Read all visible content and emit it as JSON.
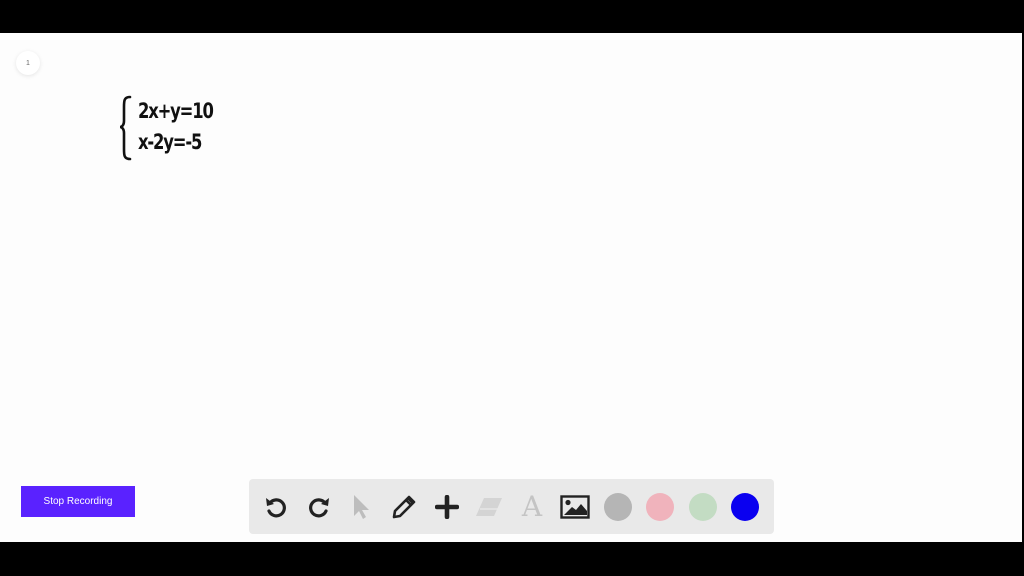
{
  "canvas": {
    "page_number": "1",
    "equations": [
      "2x+y=10",
      "x-2y=-5"
    ]
  },
  "recording": {
    "stop_label": "Stop Recording",
    "button_color": "#5a22ff"
  },
  "toolbar": {
    "tools": [
      {
        "name": "undo",
        "icon": "undo-icon",
        "enabled": true
      },
      {
        "name": "redo",
        "icon": "redo-icon",
        "enabled": true
      },
      {
        "name": "select",
        "icon": "cursor-arrow-icon",
        "enabled": false
      },
      {
        "name": "pen",
        "icon": "pencil-icon",
        "enabled": true
      },
      {
        "name": "add",
        "icon": "plus-icon",
        "enabled": true
      },
      {
        "name": "eraser",
        "icon": "eraser-icon",
        "enabled": false
      },
      {
        "name": "text",
        "icon": "text-icon",
        "enabled": false
      },
      {
        "name": "image",
        "icon": "image-icon",
        "enabled": true
      }
    ],
    "text_tool_glyph": "A",
    "colors": [
      {
        "name": "gray",
        "hex": "#b5b5b5",
        "selected": false
      },
      {
        "name": "pink",
        "hex": "#f0b3bc",
        "selected": false
      },
      {
        "name": "green",
        "hex": "#c3dcc3",
        "selected": false
      },
      {
        "name": "blue",
        "hex": "#0a00f0",
        "selected": true
      }
    ]
  }
}
